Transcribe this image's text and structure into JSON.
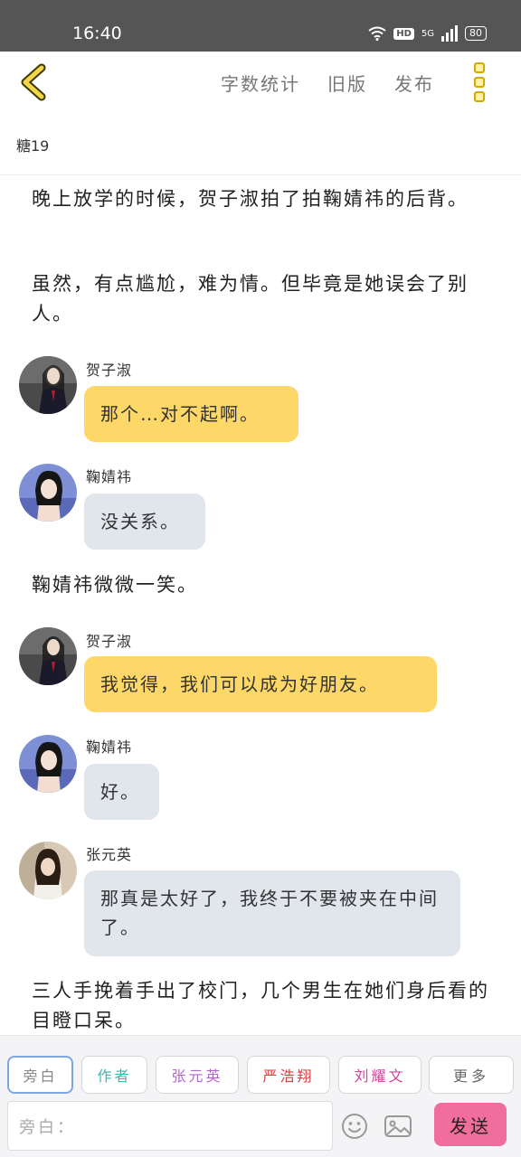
{
  "status_bar": {
    "time": "16:40",
    "network": "5G",
    "hd": "HD",
    "battery": "80"
  },
  "header": {
    "back_icon": "chevron-left-icon",
    "links": [
      "字数统计",
      "旧版",
      "发布"
    ],
    "more_icon": "vertical-dots-icon",
    "accent_color": "#d4a800"
  },
  "chapter_title": "糖19",
  "story": {
    "narration_1": "晚上放学的时候，贺子淑拍了拍鞠婧祎的后背。",
    "narration_2": "虽然，有点尴尬，难为情。但毕竟是她误会了别人。",
    "message_1": {
      "speaker": "贺子淑",
      "text": "那个…对不起啊。"
    },
    "message_2": {
      "speaker": "鞠婧祎",
      "text": "没关系。"
    },
    "narration_3": "鞠婧祎微微一笑。",
    "message_3": {
      "speaker": "贺子淑",
      "text": "我觉得，我们可以成为好朋友。"
    },
    "message_4": {
      "speaker": "鞠婧祎",
      "text": "好。"
    },
    "message_5": {
      "speaker": "张元英",
      "text": "那真是太好了，我终于不要被夹在中间了。"
    },
    "narration_4": "三人手挽着手出了校门，几个男生在她们身后看的目瞪口呆。"
  },
  "toolbar": {
    "roles": [
      {
        "label": "旁白",
        "color": "#888888"
      },
      {
        "label": "作者",
        "color": "#3fb6a8"
      },
      {
        "label": "张元英",
        "color": "#b066c9"
      },
      {
        "label": "严浩翔",
        "color": "#d04040"
      },
      {
        "label": "刘耀文",
        "color": "#d0449a"
      }
    ],
    "more_label": "更多",
    "input_placeholder": "旁白：",
    "send_label": "发送",
    "send_color": "#f06d9c"
  }
}
